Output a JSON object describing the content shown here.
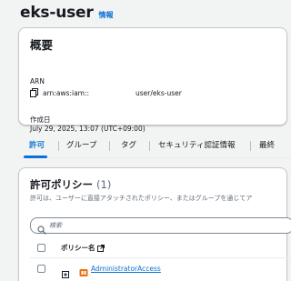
{
  "header": {
    "title": "eks-user",
    "info_label": "情報"
  },
  "summary": {
    "title": "概要",
    "arn_label": "ARN",
    "arn_prefix": "arn:aws:iam::",
    "arn_suffix": "user/eks-user",
    "created_label": "作成日",
    "created_value": "July 29, 2025, 13:07 (UTC+09:00)"
  },
  "tabs": [
    {
      "label": "許可",
      "active": true
    },
    {
      "label": "グループ",
      "active": false
    },
    {
      "label": "タグ",
      "active": false
    },
    {
      "label": "セキュリティ認証情報",
      "active": false
    },
    {
      "label": "最終",
      "active": false
    }
  ],
  "policies": {
    "title": "許可ポリシー",
    "count": "(1)",
    "description": "許可は、ユーザーに直接アタッチされたポリシー、またはグループを通じてア",
    "search_placeholder": "検索",
    "column_header": "ポリシー名",
    "rows": [
      {
        "name": "AdministratorAccess"
      }
    ]
  },
  "colors": {
    "accent": "#0972d3",
    "policy_icon": "#ec7211"
  }
}
